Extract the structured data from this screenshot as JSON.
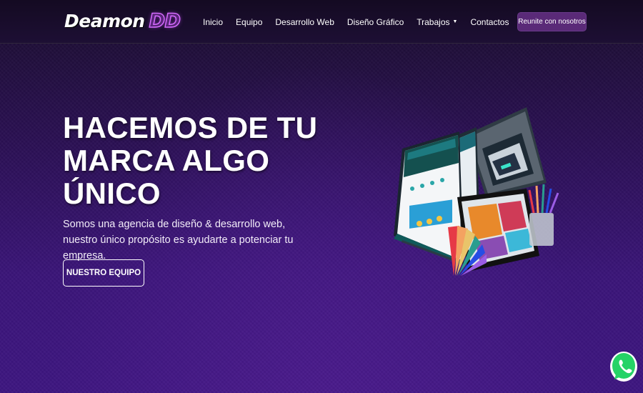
{
  "brand": {
    "logo_part1": "Deamon",
    "logo_part2": "DD"
  },
  "nav": {
    "items": [
      {
        "label": "Inicio"
      },
      {
        "label": "Equipo"
      },
      {
        "label": "Desarrollo Web"
      },
      {
        "label": "Diseño Gráfico"
      },
      {
        "label": "Trabajos",
        "dropdown": true
      },
      {
        "label": "Contactos"
      }
    ],
    "cta_label": "Reunite con nosotros"
  },
  "hero": {
    "title_lines": [
      "HACEMOS DE TU",
      "MARCA ALGO",
      "ÚNICO"
    ],
    "subtitle": "Somos una agencia de diseño & desarrollo web, nuestro único propósito es ayudarte a potenciar tu empresa.",
    "button_label": "NUESTRO EQUIPO"
  },
  "icons": {
    "dropdown": "caret-down-icon",
    "whatsapp": "whatsapp-icon"
  },
  "colors": {
    "accent": "#5a2a78",
    "logo_accent": "#d66bff",
    "whatsapp": "#25d366"
  }
}
